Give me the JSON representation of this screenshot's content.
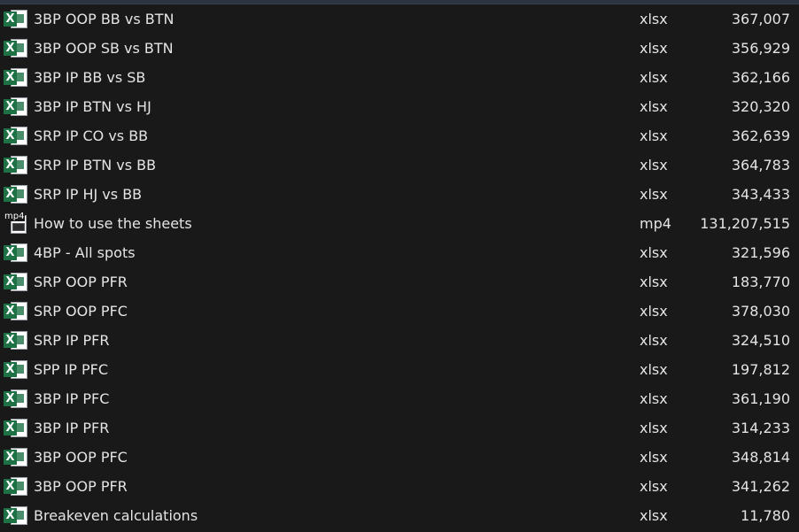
{
  "files": [
    {
      "name": "3BP OOP BB vs BTN",
      "ext": "xlsx",
      "size": "367,007",
      "icon": "excel-icon"
    },
    {
      "name": "3BP OOP SB vs BTN",
      "ext": "xlsx",
      "size": "356,929",
      "icon": "excel-icon"
    },
    {
      "name": "3BP IP BB vs SB",
      "ext": "xlsx",
      "size": "362,166",
      "icon": "excel-icon"
    },
    {
      "name": "3BP IP BTN vs HJ",
      "ext": "xlsx",
      "size": "320,320",
      "icon": "excel-icon"
    },
    {
      "name": "SRP IP CO vs BB",
      "ext": "xlsx",
      "size": "362,639",
      "icon": "excel-icon"
    },
    {
      "name": "SRP IP BTN vs BB",
      "ext": "xlsx",
      "size": "364,783",
      "icon": "excel-icon"
    },
    {
      "name": "SRP IP HJ vs BB",
      "ext": "xlsx",
      "size": "343,433",
      "icon": "excel-icon"
    },
    {
      "name": "How to use the sheets",
      "ext": "mp4",
      "size": "131,207,515",
      "icon": "video-file-icon",
      "icon_label": "mp4"
    },
    {
      "name": "4BP - All spots",
      "ext": "xlsx",
      "size": "321,596",
      "icon": "excel-icon"
    },
    {
      "name": "SRP OOP PFR",
      "ext": "xlsx",
      "size": "183,770",
      "icon": "excel-icon"
    },
    {
      "name": "SRP OOP PFC",
      "ext": "xlsx",
      "size": "378,030",
      "icon": "excel-icon"
    },
    {
      "name": "SRP IP PFR",
      "ext": "xlsx",
      "size": "324,510",
      "icon": "excel-icon"
    },
    {
      "name": "SPP IP PFC",
      "ext": "xlsx",
      "size": "197,812",
      "icon": "excel-icon"
    },
    {
      "name": "3BP IP PFC",
      "ext": "xlsx",
      "size": "361,190",
      "icon": "excel-icon"
    },
    {
      "name": "3BP IP PFR",
      "ext": "xlsx",
      "size": "314,233",
      "icon": "excel-icon"
    },
    {
      "name": "3BP OOP PFC",
      "ext": "xlsx",
      "size": "348,814",
      "icon": "excel-icon"
    },
    {
      "name": "3BP OOP PFR",
      "ext": "xlsx",
      "size": "341,262",
      "icon": "excel-icon"
    },
    {
      "name": "Breakeven calculations",
      "ext": "xlsx",
      "size": "11,780",
      "icon": "excel-icon"
    }
  ],
  "colors": {
    "background": "#191919",
    "text": "#e4e4e4",
    "excel_green": "#1e7145"
  }
}
